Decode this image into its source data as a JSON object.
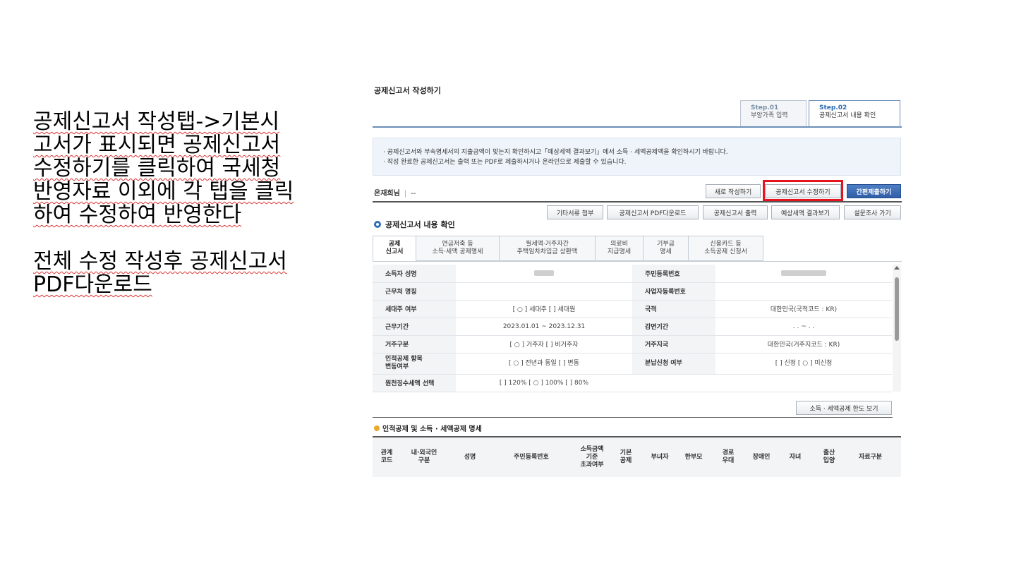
{
  "slide": {
    "paragraph1": "공제신고서 작성탭->기본시고서가 표시되면 공제신고서 수정하기를 클릭하여 국세청 반영자료 이외에 각 탭을 클릭하여 수정하여 반영한다",
    "paragraph2": "전체 수정 작성후  공제신고서 PDF다운로드"
  },
  "screen": {
    "page_title": "공제신고서 작성하기",
    "steps": [
      {
        "num": "Step.01",
        "label": "부양가족 입력"
      },
      {
        "num": "Step.02",
        "label": "공제신고서 내용 확인"
      }
    ],
    "notice": [
      "· 공제신고서와 부속명세서의 지출금액이 맞는지 확인하시고「예상세액 결과보기」에서 소득 · 세액공제액을 확인하시기 바랍니다.",
      "· 작성 완료한 공제신고서는 출력 또는 PDF로 제출하시거나 온라인으로 제출할 수 있습니다."
    ],
    "owner_label": "온재희님",
    "owner_value": "--",
    "buttons": {
      "new": "새로 작성하기",
      "edit": "공제신고서 수정하기",
      "submit": "간편제출하기",
      "attach": "기타서류 첨부",
      "pdf": "공제신고서 PDF다운로드",
      "print": "공제신고서 출력",
      "result": "예상세액 결과보기",
      "survey": "설문조사 가기",
      "limit": "소득 · 세액공제 한도 보기"
    },
    "section_title": "공제신고서 내용 확인",
    "tabs": [
      {
        "l1": "공제",
        "l2": "신고서"
      },
      {
        "l1": "연금저축 등",
        "l2": "소득·세액 공제명세"
      },
      {
        "l1": "월세액·거주자간",
        "l2": "주택임차차입금 상환액"
      },
      {
        "l1": "의료비",
        "l2": "지급명세"
      },
      {
        "l1": "기부금",
        "l2": "명세"
      },
      {
        "l1": "신용카드 등",
        "l2": "소득공제 신청서"
      }
    ],
    "info": {
      "name_label": "소득자 성명",
      "rrn_label": "주민등록번호",
      "company_label": "근무처 명칭",
      "bizno_label": "사업자등록번호",
      "head_label": "세대주 여부",
      "head_value": "[ ○ ] 세대주  [    ] 세대원",
      "nation_label": "국적",
      "nation_value": "대한민국(국적코드 : KR)",
      "period_label": "근무기간",
      "period_value": "2023.01.01 ~ 2023.12.31",
      "reduce_label": "감면기간",
      "reduce_value": ". . ~ . .",
      "resident_label": "거주구분",
      "resident_value": "[ ○ ] 거주자  [    ] 비거주자",
      "region_label": "거주지국",
      "region_value": "대한민국(거주지코드 : KR)",
      "personal_l1": "인적공제 항목",
      "personal_l2": "변동여부",
      "personal_value": "[ ○ ] 전년과 동일  [    ] 변동",
      "install_label": "분납신청 여부",
      "install_value": "[    ] 신청 [ ○ ] 미신청",
      "withhold_label": "원천징수세액 선택",
      "withhold_value": "[     ] 120%  [ ○ ] 100% [     ] 80%"
    },
    "sub_title": "인적공제 및 소득 · 세액공제 명세",
    "columns": [
      {
        "l1": "관계",
        "l2": "코드"
      },
      {
        "l1": "내·외국인",
        "l2": "구분"
      },
      {
        "l1": "성명",
        "l2": ""
      },
      {
        "l1": "주민등록번호",
        "l2": ""
      },
      {
        "l1": "소득금액",
        "l2": "기준",
        "l3": "초과여부"
      },
      {
        "l1": "기본",
        "l2": "공제"
      },
      {
        "l1": "부녀자",
        "l2": ""
      },
      {
        "l1": "한부모",
        "l2": ""
      },
      {
        "l1": "경로",
        "l2": "우대"
      },
      {
        "l1": "장애인",
        "l2": ""
      },
      {
        "l1": "자녀",
        "l2": ""
      },
      {
        "l1": "출산",
        "l2": "입양"
      },
      {
        "l1": "자료구분",
        "l2": ""
      }
    ]
  }
}
